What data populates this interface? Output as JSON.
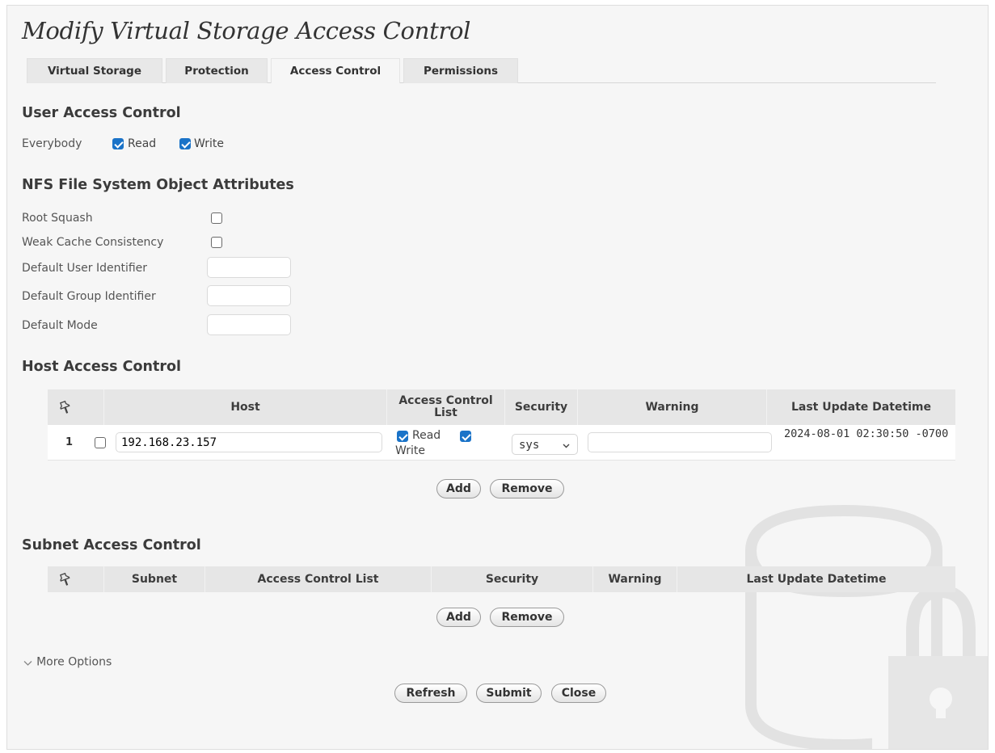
{
  "dialog": {
    "title": "Modify Virtual Storage Access Control"
  },
  "tabs": [
    {
      "label": "Virtual Storage",
      "active": false
    },
    {
      "label": "Protection",
      "active": false
    },
    {
      "label": "Access Control",
      "active": true
    },
    {
      "label": "Permissions",
      "active": false
    }
  ],
  "user_access": {
    "title": "User Access Control",
    "label": "Everybody",
    "read_label": "Read",
    "read_checked": true,
    "write_label": "Write",
    "write_checked": true
  },
  "nfs": {
    "title": "NFS File System Object Attributes",
    "root_squash_label": "Root Squash",
    "root_squash_checked": false,
    "weak_cache_label": "Weak Cache Consistency",
    "weak_cache_checked": false,
    "default_user_label": "Default User Identifier",
    "default_user_value": "",
    "default_group_label": "Default Group Identifier",
    "default_group_value": "",
    "default_mode_label": "Default Mode",
    "default_mode_value": ""
  },
  "host_access": {
    "title": "Host Access Control",
    "columns": {
      "host": "Host",
      "acl": "Access Control List",
      "security": "Security",
      "warning": "Warning",
      "last_update": "Last Update Datetime"
    },
    "rows": [
      {
        "index": "1",
        "selected": false,
        "host": "192.168.23.157",
        "read_label": "Read",
        "read_checked": true,
        "write_label": "Write",
        "write_checked": true,
        "security": "sys",
        "warning": "",
        "last_update": "2024-08-01 02:30:50 -0700"
      }
    ],
    "add_label": "Add",
    "remove_label": "Remove"
  },
  "subnet_access": {
    "title": "Subnet Access Control",
    "columns": {
      "subnet": "Subnet",
      "acl": "Access Control List",
      "security": "Security",
      "warning": "Warning",
      "last_update": "Last Update Datetime"
    },
    "rows": [],
    "add_label": "Add",
    "remove_label": "Remove"
  },
  "more_options": {
    "label": "More Options",
    "expanded": false
  },
  "footer": {
    "refresh_label": "Refresh",
    "submit_label": "Submit",
    "close_label": "Close"
  },
  "icons": {
    "pin": "pin-icon",
    "chevron": "chevron-down-icon",
    "watermark": "database-lock-icon",
    "select_arrow": "chevron-down-icon"
  },
  "colors": {
    "accent": "#1a73c8",
    "header_bg": "#e6e6e6",
    "panel_bg": "#f6f6f6"
  }
}
